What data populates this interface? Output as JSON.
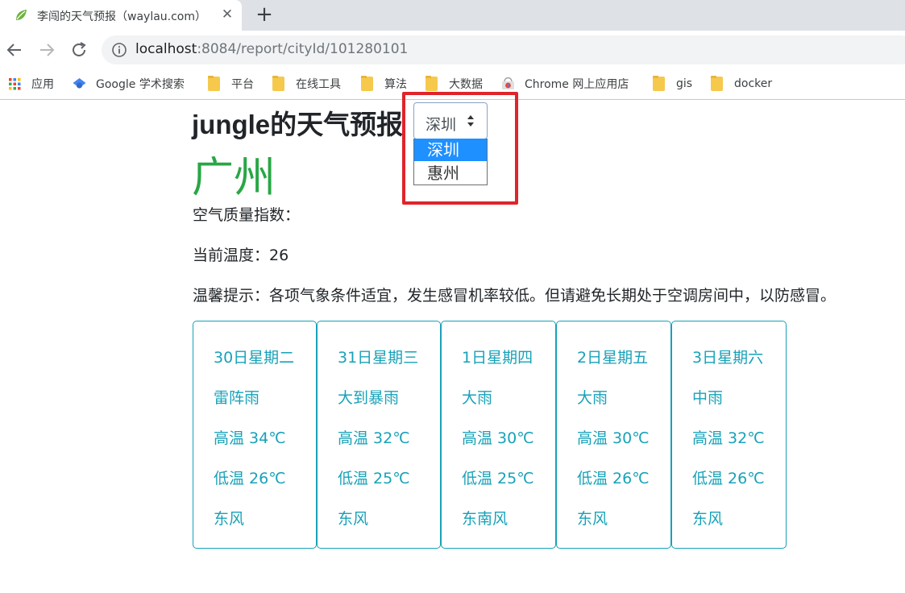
{
  "browser": {
    "tab_title": "李闯的天气预报（waylau.com）",
    "tab_close": "✕",
    "new_tab": "+",
    "url_host": "localhost",
    "url_rest": ":8084/report/cityId/101280101",
    "bookmarks": [
      {
        "label": "应用",
        "icon": "apps-grid-icon"
      },
      {
        "label": "Google 学术搜索",
        "icon": "scholar-icon"
      },
      {
        "label": "平台",
        "icon": "folder-icon"
      },
      {
        "label": "在线工具",
        "icon": "folder-icon"
      },
      {
        "label": "算法",
        "icon": "folder-icon"
      },
      {
        "label": "大数据",
        "icon": "folder-icon"
      },
      {
        "label": "Chrome 网上应用店",
        "icon": "web-store-icon"
      },
      {
        "label": "gis",
        "icon": "folder-icon"
      },
      {
        "label": "docker",
        "icon": "folder-icon"
      }
    ]
  },
  "page": {
    "title": "jungle的天气预报",
    "city_select": {
      "selected": "深圳",
      "options": [
        "深圳",
        "惠州"
      ]
    },
    "city_name": "广州",
    "aqi_label": "空气质量指数：",
    "current_temp": "当前温度：26",
    "tip": "温馨提示：各项气象条件适宜，发生感冒机率较低。但请避免长期处于空调房间中，以防感冒。"
  },
  "forecast": [
    {
      "date": "30日星期二",
      "weather": "雷阵雨",
      "high": "高温 34℃",
      "low": "低温 26℃",
      "wind": "东风"
    },
    {
      "date": "31日星期三",
      "weather": "大到暴雨",
      "high": "高温 32℃",
      "low": "低温 25℃",
      "wind": "东风"
    },
    {
      "date": "1日星期四",
      "weather": "大雨",
      "high": "高温 30℃",
      "low": "低温 25℃",
      "wind": "东南风"
    },
    {
      "date": "2日星期五",
      "weather": "大雨",
      "high": "高温 30℃",
      "low": "低温 26℃",
      "wind": "东风"
    },
    {
      "date": "3日星期六",
      "weather": "中雨",
      "high": "高温 32℃",
      "low": "低温 26℃",
      "wind": "东风"
    }
  ],
  "colors": {
    "city_green": "#28a745",
    "card_accent": "#17a2b8",
    "highlight_red": "#e0242a",
    "selected_option": "#1e90ff"
  }
}
